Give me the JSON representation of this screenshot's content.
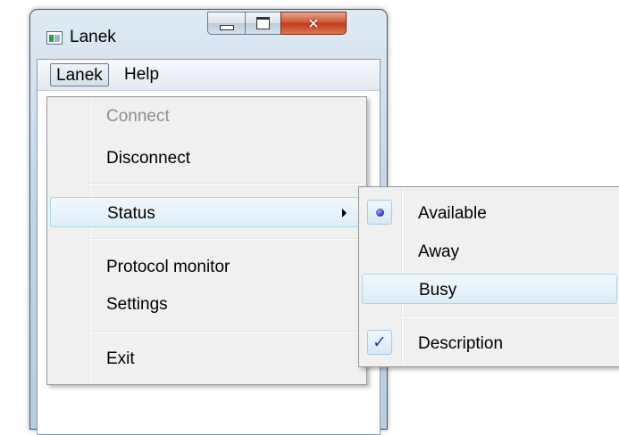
{
  "window": {
    "title": "Lanek"
  },
  "menubar": {
    "items": [
      {
        "label": "Lanek"
      },
      {
        "label": "Help"
      }
    ]
  },
  "main_menu": {
    "items": [
      {
        "label": "Connect",
        "enabled": false
      },
      {
        "label": "Disconnect",
        "enabled": true
      },
      {
        "label": "Status",
        "enabled": true,
        "has_submenu": true,
        "highlighted": true
      },
      {
        "label": "Protocol monitor",
        "enabled": true
      },
      {
        "label": "Settings",
        "enabled": true
      },
      {
        "label": "Exit",
        "enabled": true
      }
    ]
  },
  "status_submenu": {
    "items": [
      {
        "label": "Available",
        "selected": true,
        "indicator": "radio-bullet-icon"
      },
      {
        "label": "Away",
        "selected": false
      },
      {
        "label": "Busy",
        "selected": false,
        "highlighted": true
      },
      {
        "label": "Description",
        "checked": true,
        "indicator": "checkmark-icon"
      }
    ]
  },
  "colors": {
    "highlight_border": "#a8d8eb",
    "menu_background": "#f0f0f0",
    "disabled_text": "#8d8d8d",
    "close_button": "#c23a1a"
  }
}
